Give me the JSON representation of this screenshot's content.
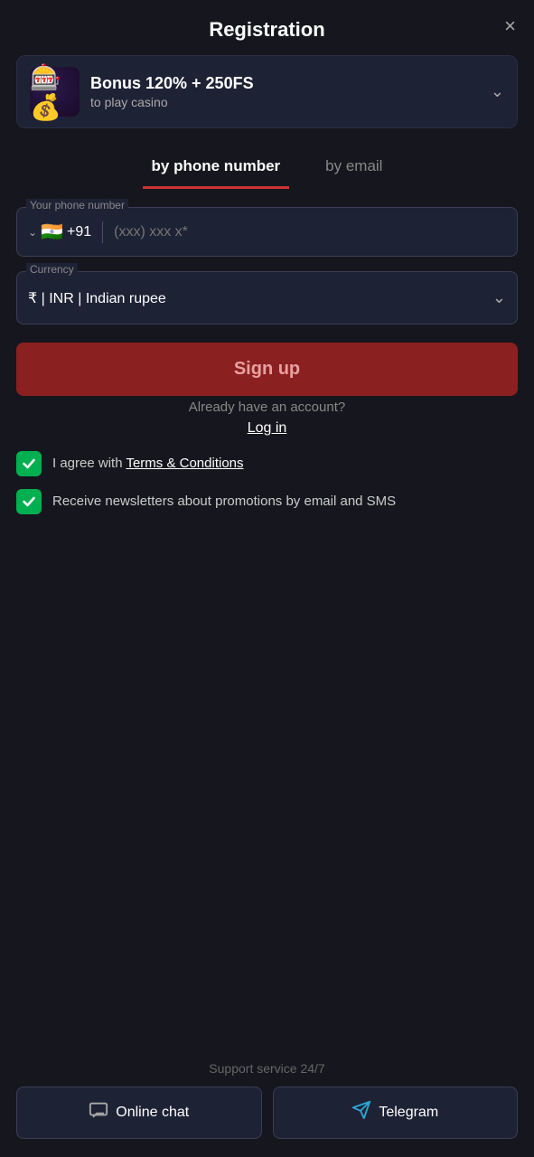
{
  "header": {
    "title": "Registration",
    "close_label": "×"
  },
  "bonus": {
    "title": "Bonus 120% + 250FS",
    "subtitle": "to play casino",
    "icon_emoji": "🎰",
    "chevron": "∨"
  },
  "tabs": [
    {
      "label": "by phone number",
      "active": true
    },
    {
      "label": "by email",
      "active": false
    }
  ],
  "phone_field": {
    "label": "Your phone number",
    "flag": "🇮🇳",
    "country_code": "+91",
    "placeholder": "(xxx) xxx x*"
  },
  "currency_field": {
    "label": "Currency",
    "value": "₹ | INR | Indian rupee"
  },
  "signup_button": {
    "label": "Sign up"
  },
  "login_section": {
    "already_text": "Already have an account?",
    "login_label": "Log in"
  },
  "checkboxes": [
    {
      "checked": true,
      "text_before": "I agree with ",
      "link_text": "Terms & Conditions",
      "text_after": ""
    },
    {
      "checked": true,
      "text_before": "Receive newsletters about promotions by email and SMS",
      "link_text": "",
      "text_after": ""
    }
  ],
  "footer": {
    "support_text": "Support service 24/7",
    "chat_button": "Online chat",
    "telegram_button": "Telegram"
  }
}
